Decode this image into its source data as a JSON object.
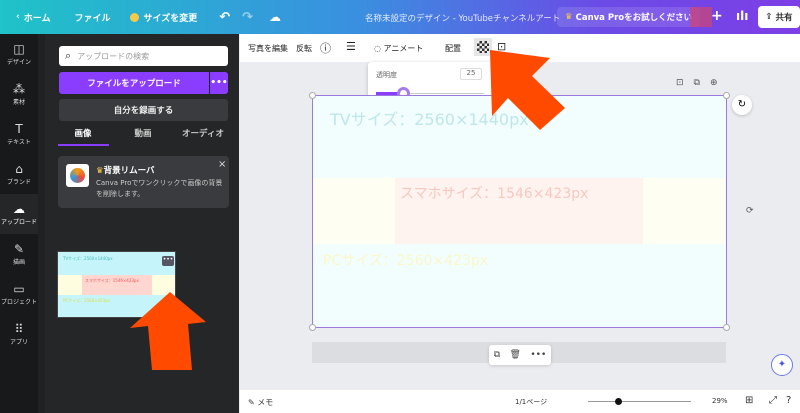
{
  "topbar": {
    "home": "ホーム",
    "file": "ファイル",
    "resize": "サイズを変更",
    "title": "名称未設定のデザイン - YouTubeチャンネルアート",
    "pro": "Canva Proをお試しください",
    "plus": "+",
    "share": "共有"
  },
  "rail": [
    {
      "label": "デザイン",
      "icon": "layout-icon"
    },
    {
      "label": "素材",
      "icon": "shapes-icon"
    },
    {
      "label": "テキスト",
      "icon": "text-icon"
    },
    {
      "label": "ブランド",
      "icon": "brand-icon"
    },
    {
      "label": "アップロード",
      "icon": "cloud-upload-icon"
    },
    {
      "label": "描画",
      "icon": "draw-icon"
    },
    {
      "label": "プロジェクト",
      "icon": "folder-icon"
    },
    {
      "label": "アプリ",
      "icon": "apps-icon"
    }
  ],
  "panel": {
    "search_placeholder": "アップロードの検索",
    "upload": "ファイルをアップロード",
    "more": "•••",
    "record": "自分を録画する",
    "tabs": [
      "画像",
      "動画",
      "オーディオ"
    ],
    "promo_title": "背景リムーバ",
    "promo_text": "Canva Proでワンクリックで画像の背景を削除します。",
    "close": "×",
    "thumb": {
      "tv": "TVサイズ：2560×1440px",
      "sp": "スマホサイズ：1546×423px",
      "pc": "PCサイズ：2560×423px"
    }
  },
  "toolbar": {
    "edit_photo": "写真を編集",
    "flip": "反転",
    "animate": "アニメート",
    "position": "配置"
  },
  "transparency": {
    "label": "透明度",
    "value": 25
  },
  "canvas": {
    "tv": "TVサイズ：2560×1440px",
    "sp": "スマホサイズ：1546×423px",
    "pc": "PCサイズ：2560×423px"
  },
  "bottom": {
    "notes": "メモ",
    "page": "1/1ページ",
    "zoom": "29%",
    "zoom_level": 29
  },
  "colors": {
    "accent": "#8b3dff",
    "arrow": "#ff4a00"
  }
}
